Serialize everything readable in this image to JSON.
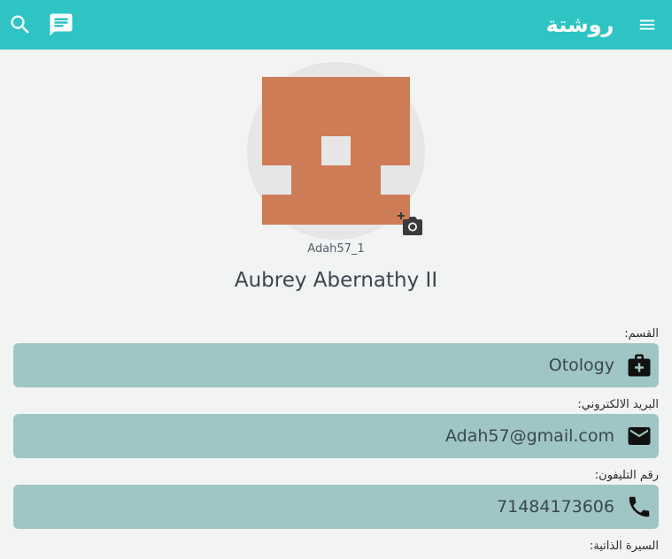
{
  "appbar": {
    "brand": "روشتة",
    "search_icon": "search-icon",
    "chat_icon": "chat-icon",
    "menu_icon": "menu-icon"
  },
  "profile": {
    "username": "Adah57_1",
    "full_name": "Aubrey Abernathy II",
    "camera_icon": "add-photo-icon"
  },
  "fields": [
    {
      "label": "القسم:",
      "value": "Otology",
      "icon": "medical-bag-icon"
    },
    {
      "label": "البريد الالكتروني:",
      "value": "Adah57@gmail.com",
      "icon": "email-icon"
    },
    {
      "label": "رقم التليفون:",
      "value": "71484173606",
      "icon": "phone-icon"
    },
    {
      "label": "السيرة الذاتية:",
      "value": "",
      "icon": ""
    }
  ],
  "colors": {
    "appbar": "#2ec4c4",
    "avatar_fg": "#ce7c56",
    "avatar_bg": "#e6e6e6",
    "field_bg": "#9fc6c4",
    "page_bg": "#f2f3f3"
  }
}
